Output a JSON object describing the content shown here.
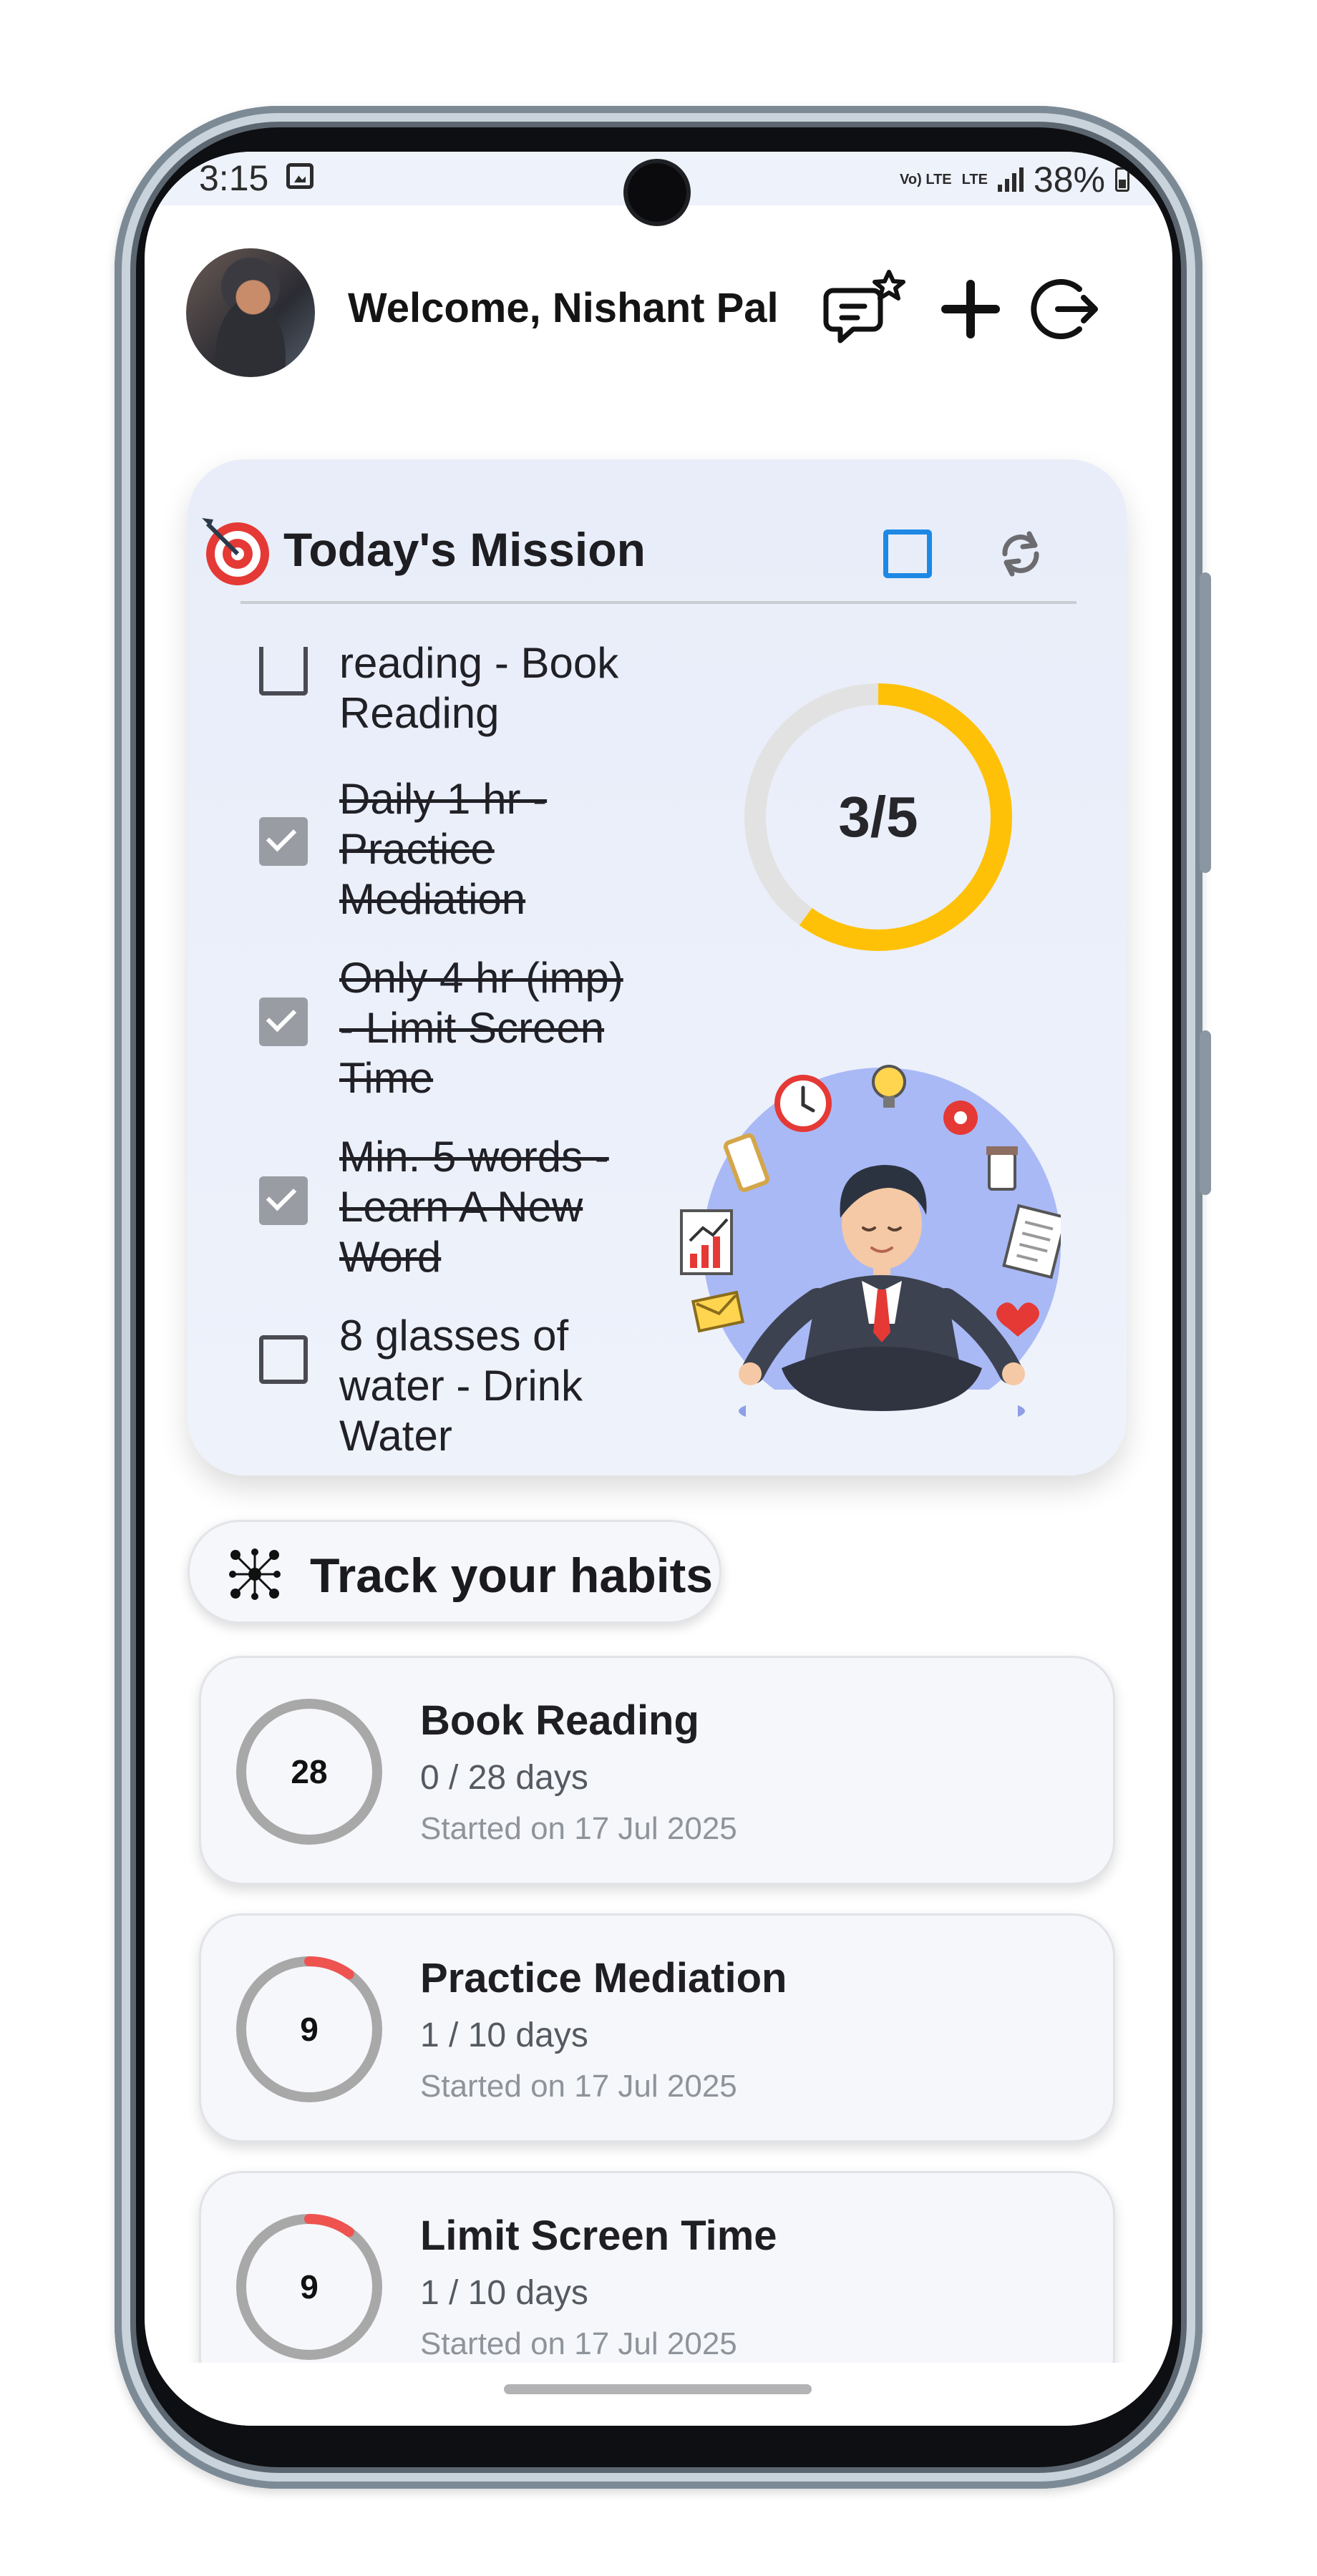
{
  "status_bar": {
    "time": "3:15",
    "network_top": "Vo) LTE",
    "network_bottom": "LTE",
    "battery": "38%"
  },
  "header": {
    "welcome": "Welcome, Nishant Pal",
    "icons": [
      "feedback-star-icon",
      "plus-icon",
      "logout-icon"
    ]
  },
  "mission": {
    "title": "Today's Mission",
    "progress_text": "3/5",
    "completed": 3,
    "total": 5,
    "accent_color": "#ffc107",
    "tasks": [
      {
        "text": "reading - Book Reading",
        "done": false
      },
      {
        "text": "Daily 1 hr - Practice Mediation",
        "done": true
      },
      {
        "text": "Only 4 hr (imp) - Limit Screen Time",
        "done": true
      },
      {
        "text": "Min. 5 words - Learn A New Word",
        "done": true
      },
      {
        "text": "8 glasses of water - Drink Water",
        "done": false
      }
    ]
  },
  "track": {
    "label": "Track your habits"
  },
  "habits": [
    {
      "count": "28",
      "name": "Book Reading",
      "days": "0 / 28 days",
      "started": "Started on 17 Jul 2025",
      "progress": 0
    },
    {
      "count": "9",
      "name": "Practice Mediation",
      "days": "1 / 10 days",
      "started": "Started on 17 Jul 2025",
      "progress": 0.1
    },
    {
      "count": "9",
      "name": "Limit Screen Time",
      "days": "1 / 10 days",
      "started": "Started on 17 Jul 2025",
      "progress": 0.1
    }
  ],
  "colors": {
    "ring_track": "#a8a8a8",
    "habit_progress": "#ef5350",
    "mission_ring_track": "#e2e2e2",
    "checkbox_blue": "#1e88e5"
  }
}
